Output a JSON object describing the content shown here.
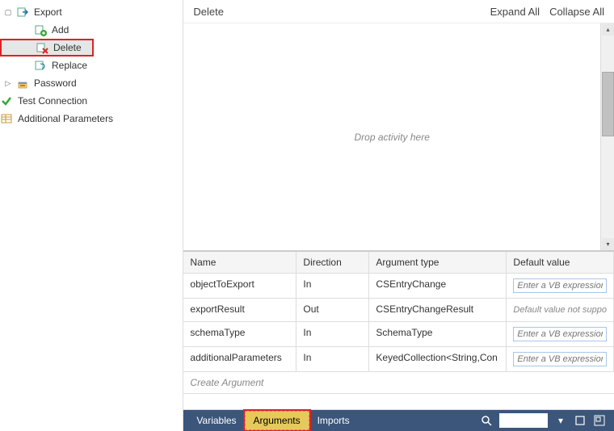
{
  "sidebar": {
    "items": [
      {
        "label": "Export",
        "expander": "▢",
        "hasExpander": true
      },
      {
        "label": "Add"
      },
      {
        "label": "Delete",
        "selected": true,
        "highlighted": true
      },
      {
        "label": "Replace"
      },
      {
        "label": "Password",
        "expander": "▷",
        "hasExpander": true
      },
      {
        "label": "Test Connection"
      },
      {
        "label": "Additional Parameters"
      }
    ]
  },
  "header": {
    "title": "Delete",
    "expandAll": "Expand All",
    "collapseAll": "Collapse All"
  },
  "designer": {
    "dropHint": "Drop activity here"
  },
  "grid": {
    "headers": {
      "name": "Name",
      "direction": "Direction",
      "type": "Argument type",
      "def": "Default value"
    },
    "rows": [
      {
        "name": "objectToExport",
        "direction": "In",
        "type": "CSEntryChange",
        "defKind": "input",
        "def": "Enter a VB expression"
      },
      {
        "name": "exportResult",
        "direction": "Out",
        "type": "CSEntryChangeResult",
        "defKind": "static",
        "def": "Default value not suppo"
      },
      {
        "name": "schemaType",
        "direction": "In",
        "type": "SchemaType",
        "defKind": "input",
        "def": "Enter a VB expression"
      },
      {
        "name": "additionalParameters",
        "direction": "In",
        "type": "KeyedCollection<String,Con",
        "defKind": "input",
        "def": "Enter a VB expression"
      }
    ],
    "createLabel": "Create Argument"
  },
  "statusbar": {
    "variables": "Variables",
    "arguments": "Arguments",
    "imports": "Imports"
  },
  "icons": {
    "export": "export-icon",
    "add": "add-icon",
    "delete": "delete-icon",
    "replace": "replace-icon",
    "password": "password-icon",
    "test": "check-icon",
    "params": "params-icon"
  }
}
